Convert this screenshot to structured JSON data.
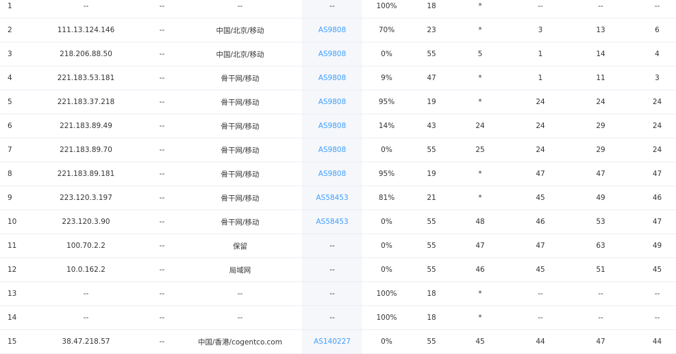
{
  "rows": [
    {
      "hop": "1",
      "ip": "--",
      "host": "--",
      "location": "--",
      "asn": "--",
      "loss": "100%",
      "sent": "18",
      "last": "*",
      "avg": "--",
      "worst": "--",
      "best": "--"
    },
    {
      "hop": "2",
      "ip": "111.13.124.146",
      "host": "--",
      "location": "中国/北京/移动",
      "asn": "AS9808",
      "loss": "70%",
      "sent": "23",
      "last": "*",
      "avg": "3",
      "worst": "13",
      "best": "6"
    },
    {
      "hop": "3",
      "ip": "218.206.88.50",
      "host": "--",
      "location": "中国/北京/移动",
      "asn": "AS9808",
      "loss": "0%",
      "sent": "55",
      "last": "5",
      "avg": "1",
      "worst": "14",
      "best": "4"
    },
    {
      "hop": "4",
      "ip": "221.183.53.181",
      "host": "--",
      "location": "骨干网/移动",
      "asn": "AS9808",
      "loss": "9%",
      "sent": "47",
      "last": "*",
      "avg": "1",
      "worst": "11",
      "best": "3"
    },
    {
      "hop": "5",
      "ip": "221.183.37.218",
      "host": "--",
      "location": "骨干网/移动",
      "asn": "AS9808",
      "loss": "95%",
      "sent": "19",
      "last": "*",
      "avg": "24",
      "worst": "24",
      "best": "24"
    },
    {
      "hop": "6",
      "ip": "221.183.89.49",
      "host": "--",
      "location": "骨干网/移动",
      "asn": "AS9808",
      "loss": "14%",
      "sent": "43",
      "last": "24",
      "avg": "24",
      "worst": "29",
      "best": "24"
    },
    {
      "hop": "7",
      "ip": "221.183.89.70",
      "host": "--",
      "location": "骨干网/移动",
      "asn": "AS9808",
      "loss": "0%",
      "sent": "55",
      "last": "25",
      "avg": "24",
      "worst": "29",
      "best": "24"
    },
    {
      "hop": "8",
      "ip": "221.183.89.181",
      "host": "--",
      "location": "骨干网/移动",
      "asn": "AS9808",
      "loss": "95%",
      "sent": "19",
      "last": "*",
      "avg": "47",
      "worst": "47",
      "best": "47"
    },
    {
      "hop": "9",
      "ip": "223.120.3.197",
      "host": "--",
      "location": "骨干网/移动",
      "asn": "AS58453",
      "loss": "81%",
      "sent": "21",
      "last": "*",
      "avg": "45",
      "worst": "49",
      "best": "46"
    },
    {
      "hop": "10",
      "ip": "223.120.3.90",
      "host": "--",
      "location": "骨干网/移动",
      "asn": "AS58453",
      "loss": "0%",
      "sent": "55",
      "last": "48",
      "avg": "46",
      "worst": "53",
      "best": "47"
    },
    {
      "hop": "11",
      "ip": "100.70.2.2",
      "host": "--",
      "location": "保留",
      "asn": "--",
      "loss": "0%",
      "sent": "55",
      "last": "47",
      "avg": "47",
      "worst": "63",
      "best": "49"
    },
    {
      "hop": "12",
      "ip": "10.0.162.2",
      "host": "--",
      "location": "局域网",
      "asn": "--",
      "loss": "0%",
      "sent": "55",
      "last": "46",
      "avg": "45",
      "worst": "51",
      "best": "45"
    },
    {
      "hop": "13",
      "ip": "--",
      "host": "--",
      "location": "--",
      "asn": "--",
      "loss": "100%",
      "sent": "18",
      "last": "*",
      "avg": "--",
      "worst": "--",
      "best": "--"
    },
    {
      "hop": "14",
      "ip": "--",
      "host": "--",
      "location": "--",
      "asn": "--",
      "loss": "100%",
      "sent": "18",
      "last": "*",
      "avg": "--",
      "worst": "--",
      "best": "--"
    },
    {
      "hop": "15",
      "ip": "38.47.218.57",
      "host": "--",
      "location": "中国/香港/cogentco.com",
      "asn": "AS140227",
      "loss": "0%",
      "sent": "55",
      "last": "45",
      "avg": "44",
      "worst": "47",
      "best": "44"
    }
  ]
}
